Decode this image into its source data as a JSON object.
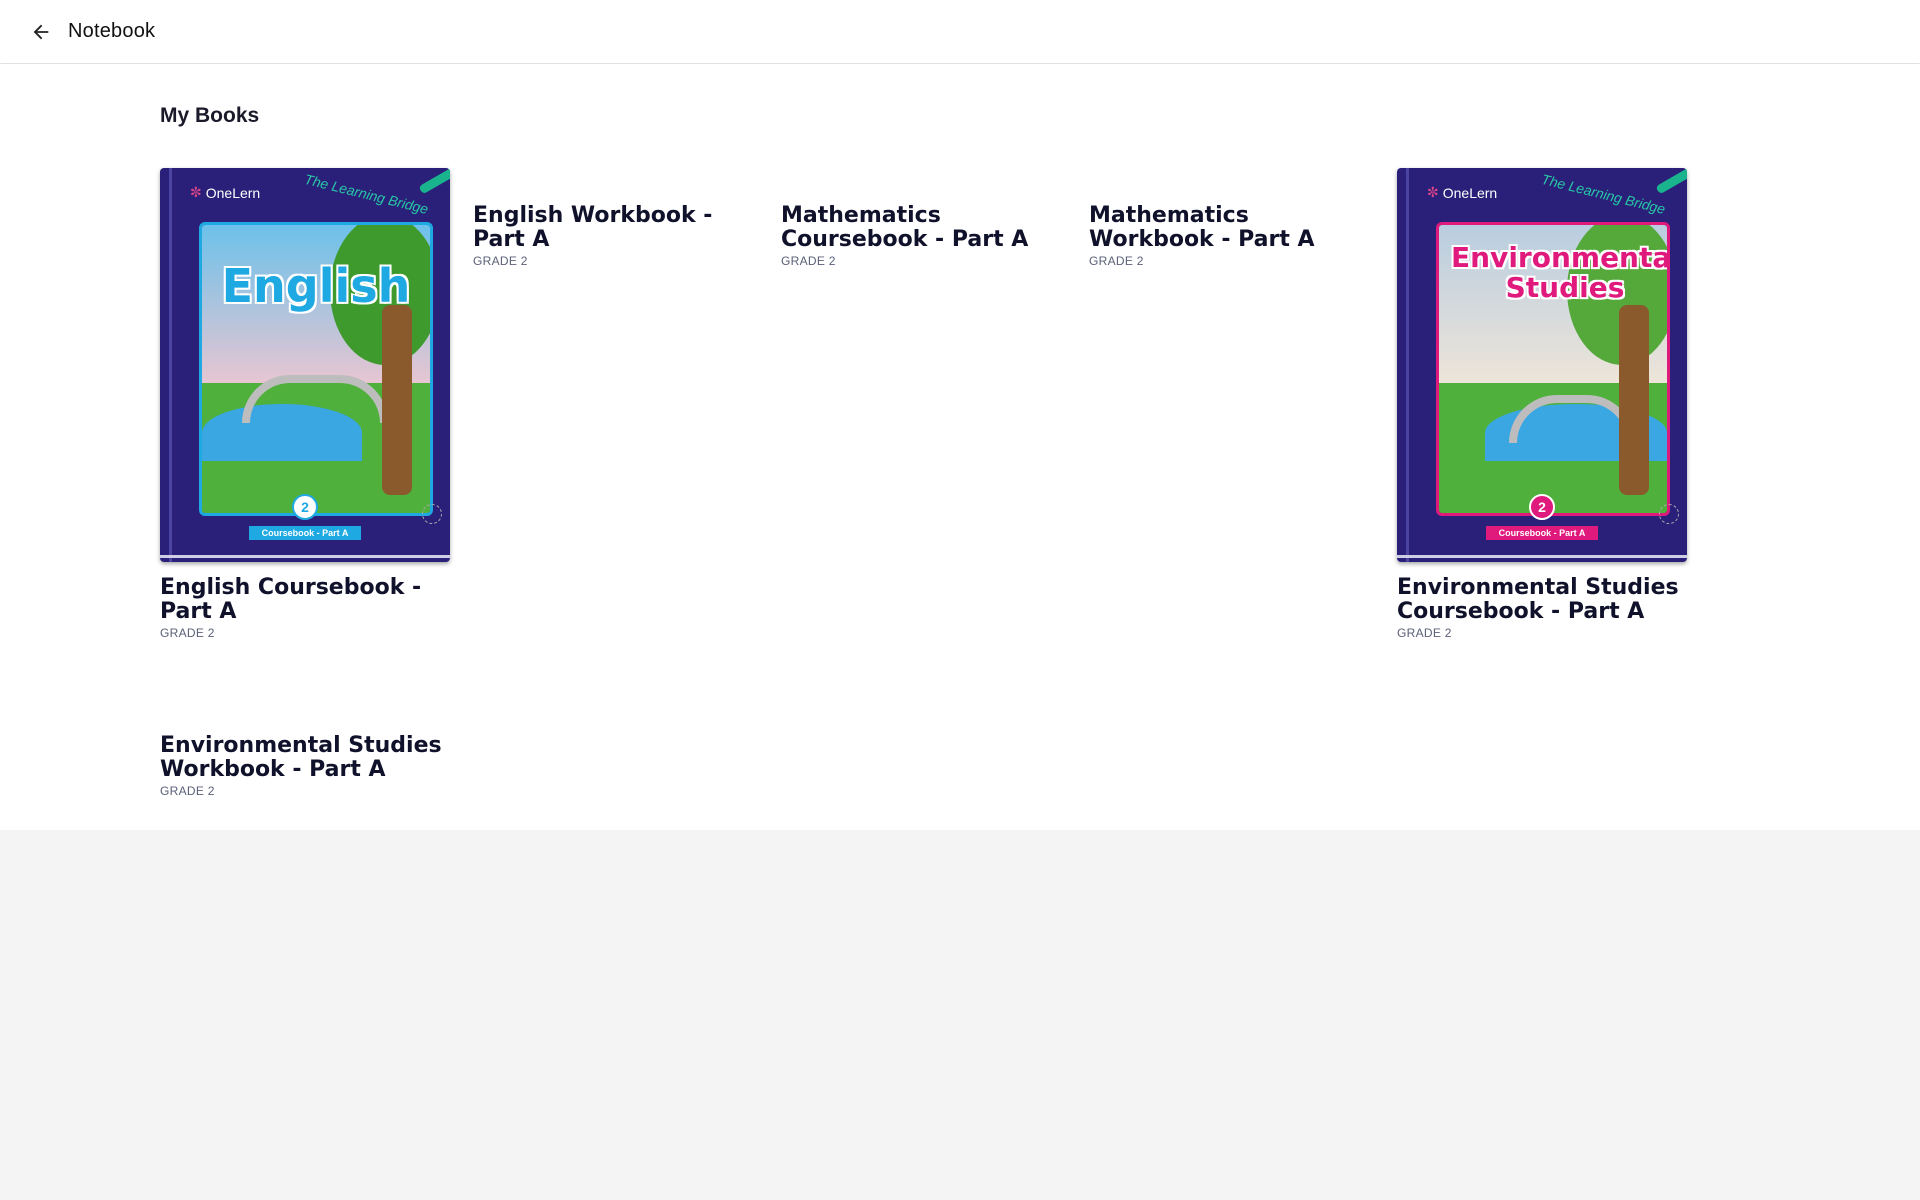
{
  "header": {
    "back_icon": "arrow-left-icon",
    "title": "Notebook"
  },
  "main": {
    "section_title": "My Books",
    "books": [
      {
        "title": "English Coursebook - Part A",
        "grade": "GRADE 2",
        "has_cover": true,
        "cover": {
          "brand": "OneLern",
          "tagline": "The Learning Bridge",
          "subject": "English",
          "grade_number": "2",
          "ribbon": "Coursebook - Part A",
          "accent_color": "#1fa9e2",
          "subject_color": "#1fa9e2",
          "sky_color": "#f3c6d0"
        }
      },
      {
        "title": "English Workbook - Part A",
        "grade": "GRADE 2",
        "has_cover": false
      },
      {
        "title": "Mathematics Coursebook - Part A",
        "grade": "GRADE 2",
        "has_cover": false
      },
      {
        "title": "Mathematics Workbook - Part A",
        "grade": "GRADE 2",
        "has_cover": false
      },
      {
        "title": "Environmental Studies Coursebook - Part A",
        "grade": "GRADE 2",
        "has_cover": true,
        "cover": {
          "brand": "OneLern",
          "tagline": "The Learning Bridge",
          "subject": "Environmental Studies",
          "grade_number": "2",
          "ribbon": "Coursebook - Part A",
          "accent_color": "#e0197d",
          "subject_color": "#e0197d",
          "sky_color": "#c9dbe8"
        }
      },
      {
        "title": "Environmental Studies Workbook - Part A",
        "grade": "GRADE 2",
        "has_cover": false
      }
    ]
  },
  "colors": {
    "cover_bg": "#2a2079",
    "page_bg": "#f4f4f4",
    "content_bg": "#ffffff"
  }
}
